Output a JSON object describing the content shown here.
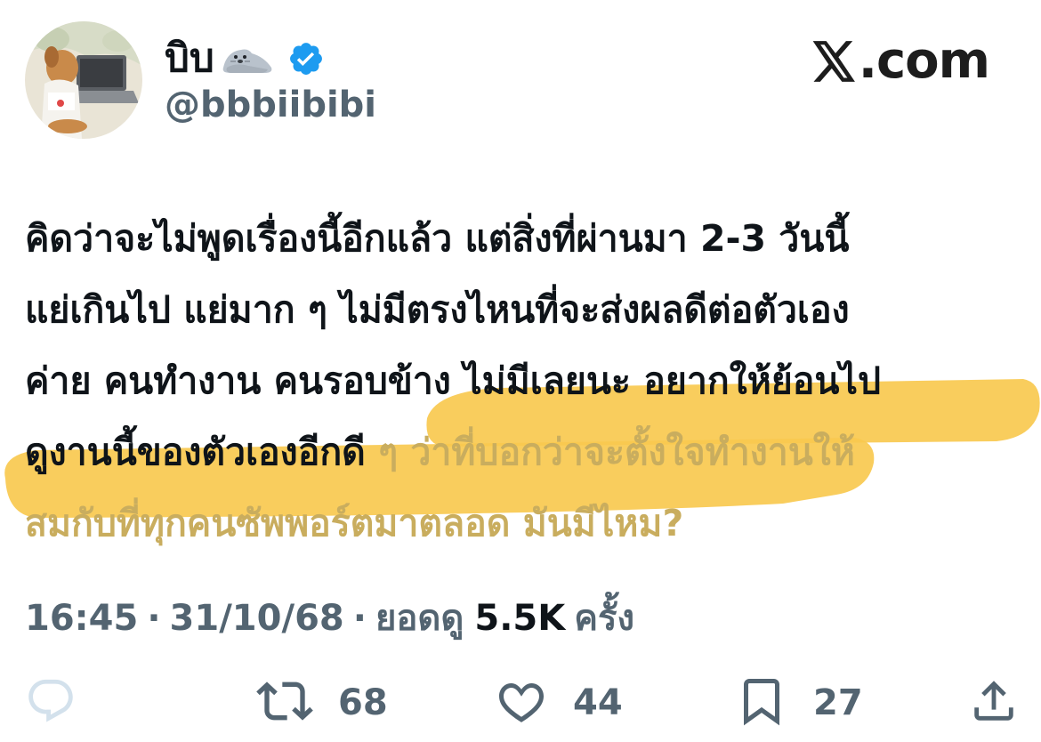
{
  "author": {
    "display_name": "บิบ",
    "handle": "@bbbiibibi",
    "verified": true
  },
  "brand": {
    "label": ".com"
  },
  "tweet": {
    "text_plain": "คิดว่าจะไม่พูดเรื่องนี้อีกแล้ว แต่สิ่งที่ผ่านมา 2-3 วันนี้\nแย่เกินไป แย่มาก ๆ ไม่มีตรงไหนที่จะส่งผลดีต่อตัวเอง\nค่าย คนทำงาน คนรอบข้าง ไม่มีเลยนะ อยากให้ย้อนไป\nดูงานนี้ของตัวเองอีกดี ",
    "text_highlighted": "ๆ ว่าที่บอกว่าจะตั้งใจทำงานให้\nสมกับที่ทุกคนซัพพอร์ตมาตลอด มันมีไหม?",
    "highlight_color": "#f9c94f"
  },
  "meta": {
    "time": "16:45",
    "date": "31/10/68",
    "views_label": "ยอดดู",
    "views_count": "5.5K",
    "views_suffix": "ครั้ง",
    "separator": "·"
  },
  "actions": {
    "reply_count": "",
    "retweet_count": "68",
    "like_count": "44",
    "bookmark_count": "27"
  },
  "colors": {
    "text": "#0f1419",
    "secondary": "#536471",
    "verified": "#1d9bf0",
    "highlight": "#f9c94f"
  }
}
